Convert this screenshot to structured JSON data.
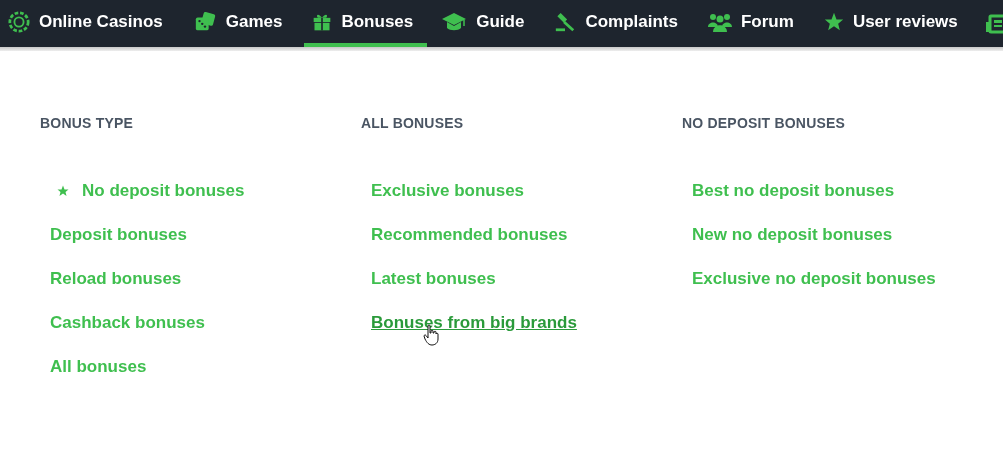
{
  "nav": {
    "items": [
      {
        "label": "Online Casinos",
        "selected": false
      },
      {
        "label": "Games",
        "selected": false
      },
      {
        "label": "Bonuses",
        "selected": true
      },
      {
        "label": "Guide",
        "selected": false
      },
      {
        "label": "Complaints",
        "selected": false
      },
      {
        "label": "Forum",
        "selected": false
      },
      {
        "label": "User reviews",
        "selected": false
      }
    ]
  },
  "menu": {
    "columns": [
      {
        "heading": "BONUS TYPE",
        "links": [
          {
            "label": "No deposit bonuses",
            "starred": true,
            "hovered": false
          },
          {
            "label": "Deposit bonuses",
            "starred": false,
            "hovered": false
          },
          {
            "label": "Reload bonuses",
            "starred": false,
            "hovered": false
          },
          {
            "label": "Cashback bonuses",
            "starred": false,
            "hovered": false
          },
          {
            "label": "All bonuses",
            "starred": false,
            "hovered": false
          }
        ]
      },
      {
        "heading": "ALL BONUSES",
        "links": [
          {
            "label": "Exclusive bonuses",
            "starred": false,
            "hovered": false
          },
          {
            "label": "Recommended bonuses",
            "starred": false,
            "hovered": false
          },
          {
            "label": "Latest bonuses",
            "starred": false,
            "hovered": false
          },
          {
            "label": "Bonuses from big brands",
            "starred": false,
            "hovered": true
          }
        ]
      },
      {
        "heading": "NO DEPOSIT BONUSES",
        "links": [
          {
            "label": "Best no deposit bonuses",
            "starred": false,
            "hovered": false
          },
          {
            "label": "New no deposit bonuses",
            "starred": false,
            "hovered": false
          },
          {
            "label": "Exclusive no deposit bonuses",
            "starred": false,
            "hovered": false
          }
        ]
      }
    ]
  }
}
